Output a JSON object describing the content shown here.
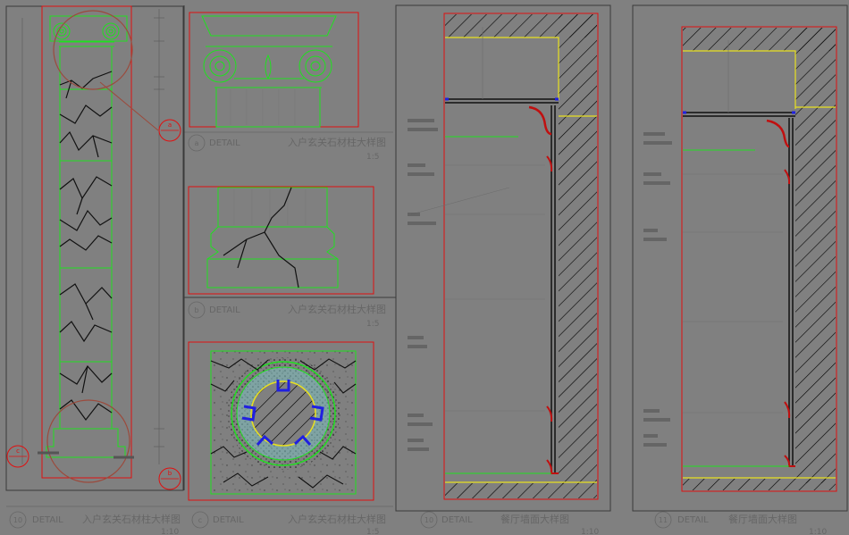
{
  "colors": {
    "background": "#808080",
    "frame": "#3a3a3a",
    "border_red": "#e01010",
    "line_green": "#20e020",
    "line_yellow": "#e8e020",
    "line_blue": "#2020e0",
    "crack": "#111111",
    "callout": "#9b4a3c",
    "hatch": "#000000",
    "text_gray": "#5a5a5a"
  },
  "icons": [
    "ionic-volute-icon",
    "section-callout-icon",
    "stone-crack-texture"
  ],
  "callouts": {
    "a": "a",
    "b": "b",
    "c": "c"
  },
  "details": {
    "a": {
      "number": "a",
      "label": "DETAIL",
      "title": "入户玄关石材柱大样图",
      "scale": "1:5"
    },
    "b": {
      "number": "b",
      "label": "DETAIL",
      "title": "入户玄关石材柱大样图",
      "scale": "1:5"
    },
    "d10": {
      "number": "10",
      "label": "DETAIL",
      "title": "入户玄关石材柱大样图",
      "scale": "1:10"
    },
    "c": {
      "number": "c",
      "label": "DETAIL",
      "title": "入户玄关石材柱大样图",
      "scale": "1:5"
    },
    "d10b": {
      "number": "10",
      "label": "DETAIL",
      "title": "餐厅墙面大样图",
      "scale": "1:10"
    },
    "d11": {
      "number": "11",
      "label": "DETAIL",
      "title": "餐厅墙面大样图",
      "scale": "1:10"
    }
  }
}
